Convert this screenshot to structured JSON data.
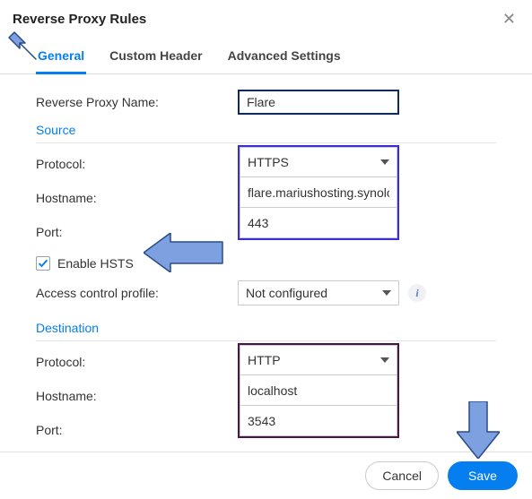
{
  "dialog": {
    "title": "Reverse Proxy Rules"
  },
  "tabs": {
    "general": "General",
    "custom_header": "Custom Header",
    "advanced": "Advanced Settings"
  },
  "labels": {
    "proxy_name": "Reverse Proxy Name:",
    "source": "Source",
    "protocol": "Protocol:",
    "hostname": "Hostname:",
    "port": "Port:",
    "enable_hsts": "Enable HSTS",
    "access_profile": "Access control profile:",
    "destination": "Destination"
  },
  "values": {
    "proxy_name": "Flare",
    "src_protocol": "HTTPS",
    "src_hostname": "flare.mariushosting.synology",
    "src_port": "443",
    "hsts_checked": true,
    "access_profile": "Not configured",
    "dst_protocol": "HTTP",
    "dst_hostname": "localhost",
    "dst_port": "3543"
  },
  "footer": {
    "cancel": "Cancel",
    "save": "Save"
  },
  "icons": {
    "info": "i"
  },
  "colors": {
    "accent": "#057fef"
  }
}
